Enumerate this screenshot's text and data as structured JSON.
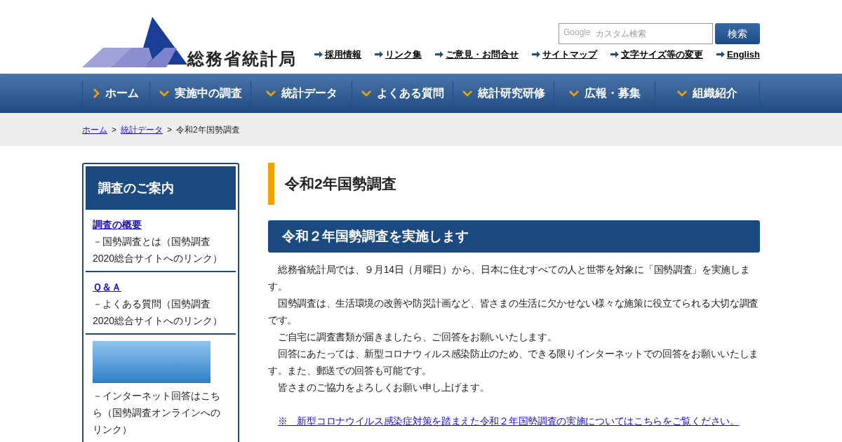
{
  "header": {
    "site_name": "総務省統計局",
    "search": {
      "logo_text": "Google",
      "placeholder": "カスタム検索",
      "button": "検索"
    },
    "utility_links": [
      "採用情報",
      "リンク集",
      "ご意見・お問合せ",
      "サイトマップ",
      "文字サイズ等の変更",
      "English"
    ]
  },
  "nav": [
    {
      "label": "ホーム",
      "kind": "link"
    },
    {
      "label": "実施中の調査",
      "kind": "menu"
    },
    {
      "label": "統計データ",
      "kind": "menu"
    },
    {
      "label": "よくある質問",
      "kind": "menu"
    },
    {
      "label": "統計研究研修",
      "kind": "menu"
    },
    {
      "label": "広報・募集",
      "kind": "menu"
    },
    {
      "label": "組織紹介",
      "kind": "menu"
    }
  ],
  "breadcrumb_separator": ">",
  "breadcrumb": [
    {
      "label": "ホーム",
      "kind": "link"
    },
    {
      "label": "統計データ",
      "kind": "link"
    },
    {
      "label": "令和2年国勢調査",
      "kind": "current"
    }
  ],
  "sidebar": {
    "title": "調査のご案内",
    "items": [
      {
        "kind": "link",
        "link": "調査の概要",
        "text": "－国勢調査とは（国勢調査2020総合サイトへのリンク）"
      },
      {
        "kind": "link",
        "link": "Ｑ＆Ａ",
        "text": "－よくある質問（国勢調査2020総合サイトへのリンク）"
      },
      {
        "kind": "banner",
        "text": "－インターネット回答はこちら（国勢調査オンラインへのリンク）"
      }
    ]
  },
  "main": {
    "title": "令和2年国勢調査",
    "section_title": "令和２年国勢調査を実施します",
    "paragraphs": [
      "総務省統計局では、９月14日（月曜日）から、日本に住むすべての人と世帯を対象に「国勢調査」を実施します。",
      "国勢調査は、生活環境の改善や防災計画など、皆さまの生活に欠かせない様々な施策に役立てられる大切な調査です。",
      "ご自宅に調査書類が届きましたら、ご回答をお願いいたします。",
      "回答にあたっては、新型コロナウィルス感染防止のため、できる限りインターネットでの回答をお願いいたします。また、郵送での回答も可能です。",
      "皆さまのご協力をよろしくお願い申し上げます。"
    ],
    "notice_link": "※　新型コロナウイルス感染症対策を踏まえた令和２年国勢調査の実施についてはこちらをご覧ください。"
  }
}
